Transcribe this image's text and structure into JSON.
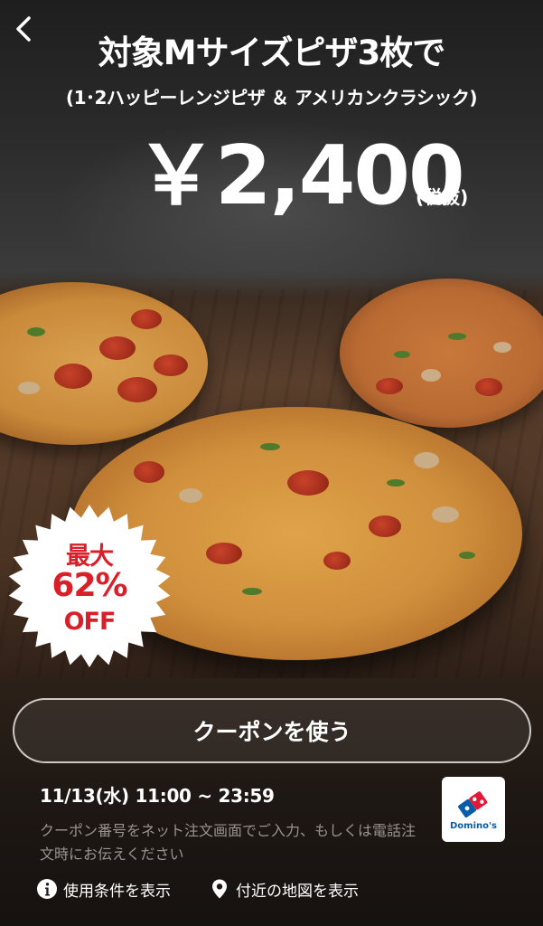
{
  "nav": {
    "back_icon": "chevron-left-icon"
  },
  "promo": {
    "headline": "対象Mサイズピザ3枚で",
    "subline": "(1･2ハッピーレンジピザ ＆ アメリカンクラシック)",
    "price": "￥2,400",
    "tax_note": "(税抜)"
  },
  "badge": {
    "line1": "最大",
    "line2": "62%",
    "line3": "OFF",
    "color": "#d8202a"
  },
  "footer": {
    "use_button_label": "クーポンを使う",
    "valid_time": "11/13(水) 11:00 ~ 23:59",
    "note": "クーポン番号をネット注文画面でご入力、もしくは電話注文時にお伝えください",
    "brand_name": "Domino's",
    "brand_color": "#0a5ca8",
    "links": {
      "conditions_label": "使用条件を表示",
      "conditions_icon": "info-icon",
      "map_label": "付近の地図を表示",
      "map_icon": "location-pin-icon"
    }
  }
}
